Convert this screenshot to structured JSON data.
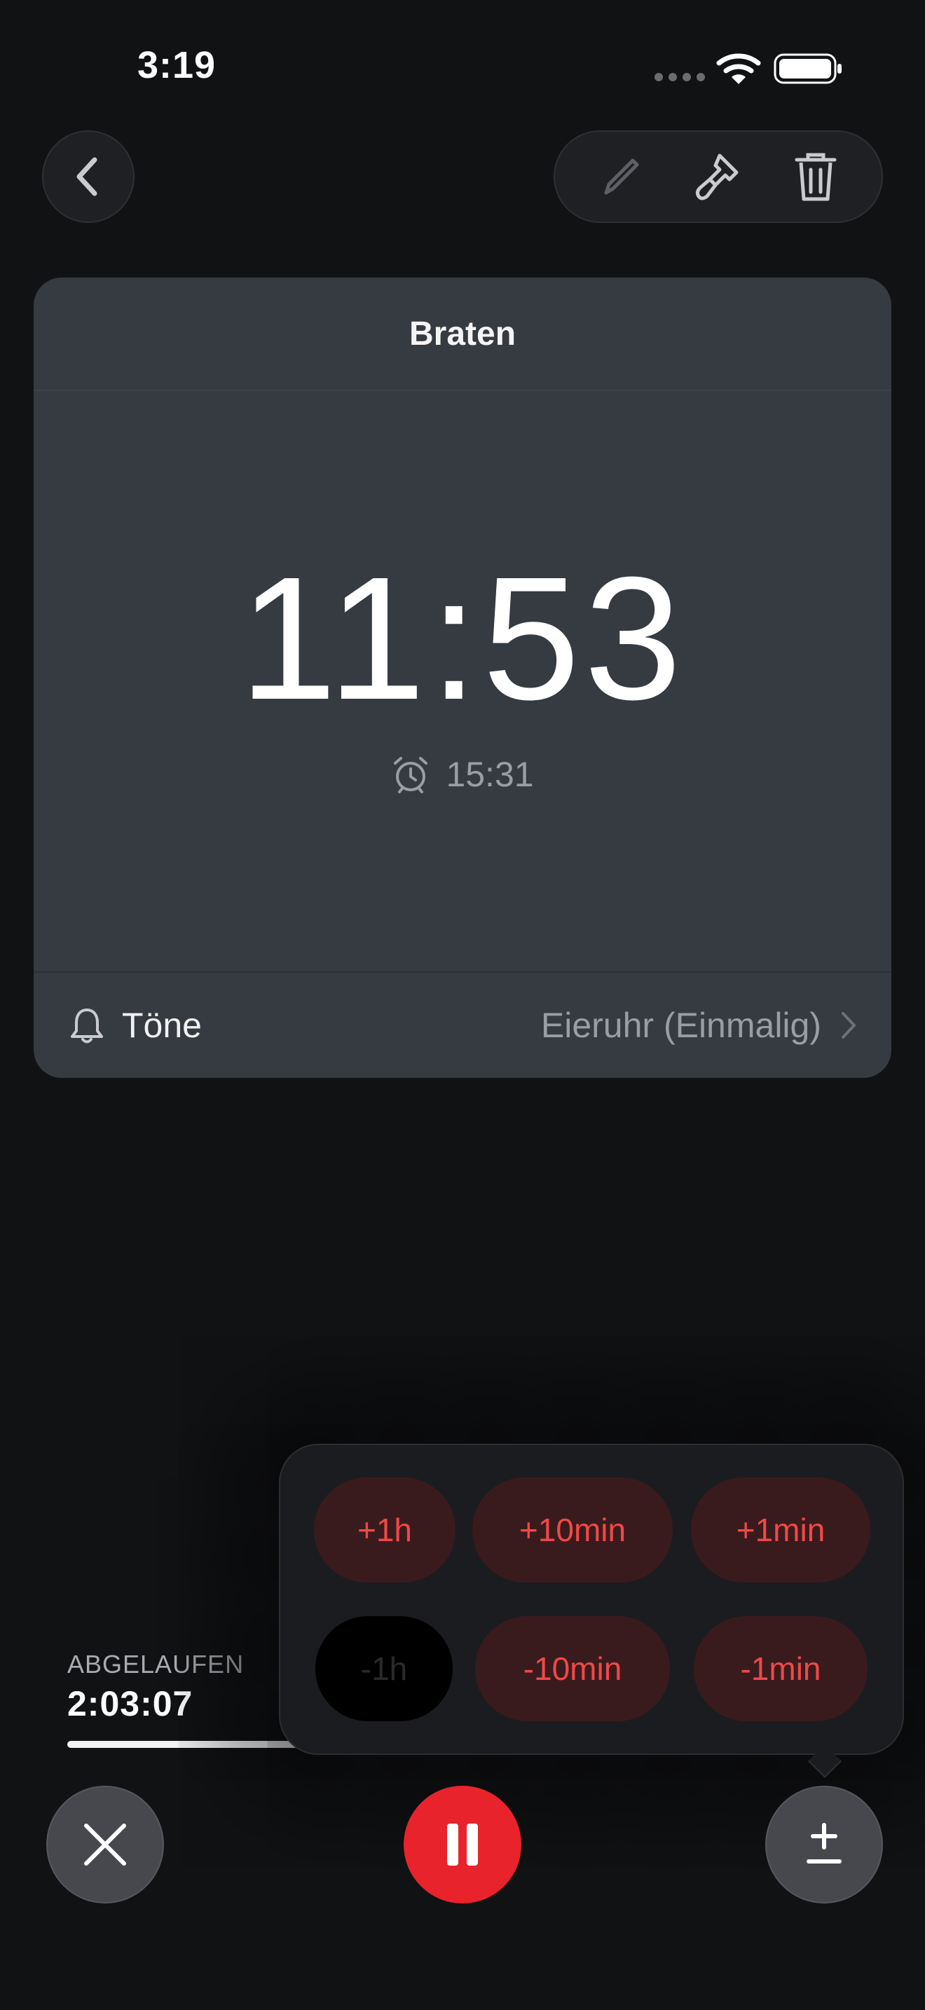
{
  "status_bar": {
    "time": "3:19"
  },
  "card": {
    "title": "Braten",
    "remaining": "11:53",
    "alarm_time": "15:31",
    "tones": {
      "label": "Töne",
      "value": "Eieruhr (Einmalig)"
    }
  },
  "elapsed": {
    "caption": "ABGELAUFEN",
    "value": "2:03:07",
    "progress": 0.38
  },
  "adjust_popover": {
    "row1": [
      "+1h",
      "+10min",
      "+1min"
    ],
    "row2": [
      "-1h",
      "-10min",
      "-1min"
    ]
  },
  "colors": {
    "accent_red": "#e8232c",
    "adjust_text": "#f04848",
    "card_bg": "#363a41"
  },
  "icons": [
    "chevron-left-icon",
    "pencil-icon",
    "paintbrush-icon",
    "trash-icon",
    "alarm-clock-icon",
    "bell-icon",
    "chevron-right-icon",
    "close-icon",
    "pause-icon",
    "plus-minus-icon"
  ]
}
